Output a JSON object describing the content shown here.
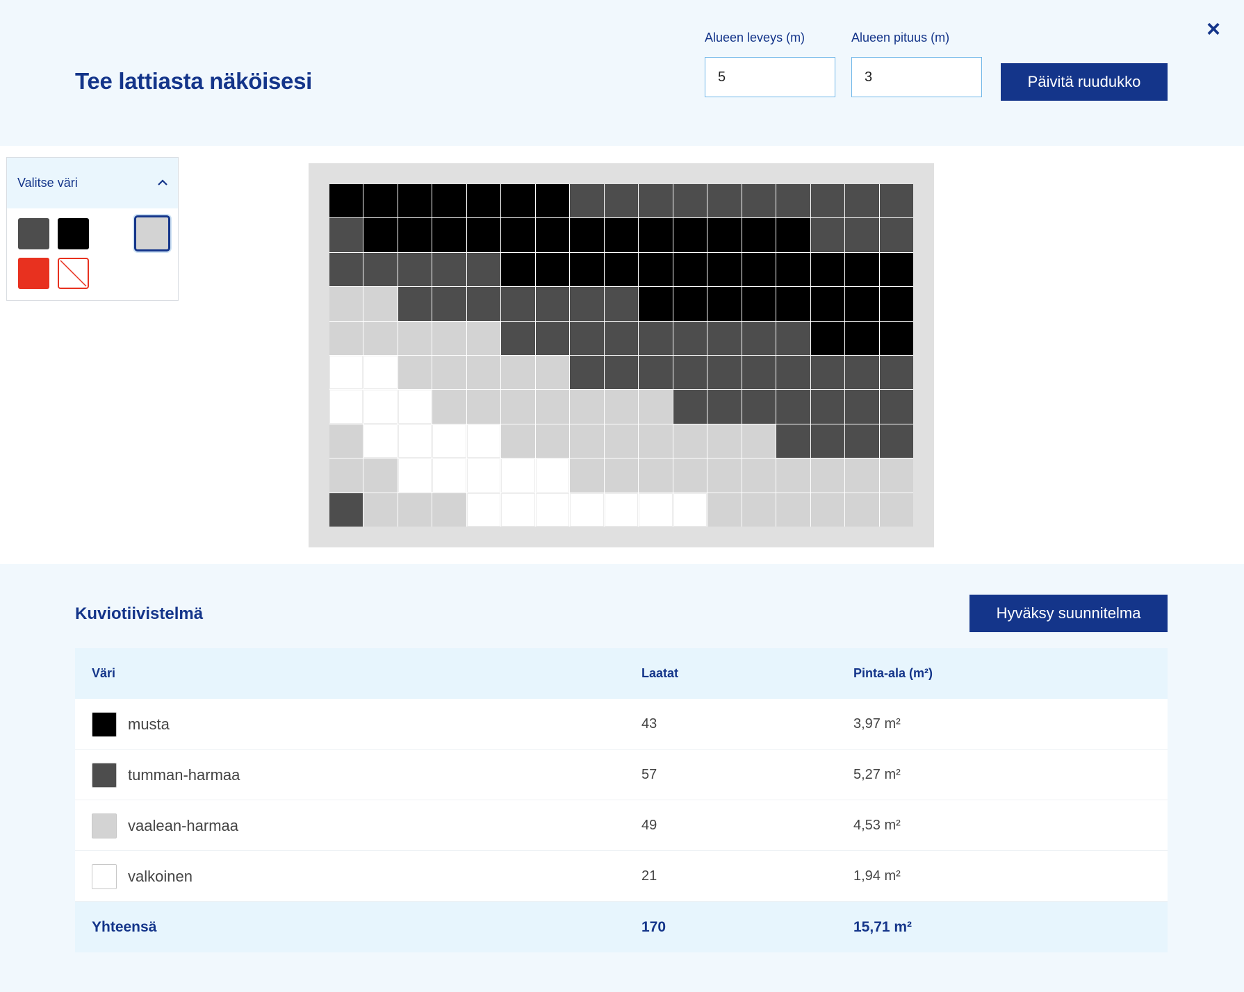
{
  "header": {
    "title": "Tee lattiasta näköisesi",
    "width_label": "Alueen leveys (m)",
    "width_value": "5",
    "length_label": "Alueen pituus (m)",
    "length_value": "3",
    "update_button": "Päivitä ruudukko",
    "close_icon": "×"
  },
  "palette": {
    "title": "Valitse väri",
    "collapse_icon": "chevron-up-icon",
    "colors": {
      "dark_gray": "#4d4d4d",
      "black": "#000000",
      "white": "#ffffff",
      "light_gray": "#d3d3d3",
      "red": "#e8311f",
      "selected_border": "#14358a"
    },
    "selected": "light_gray"
  },
  "grid": {
    "columns": 17,
    "rows_count": 10,
    "legend": {
      "B": "#000000",
      "D": "#4d4d4d",
      "L": "#d3d3d3",
      "W": "#ffffff"
    },
    "rows": [
      "BBBBBBBDDDDDDDDDD",
      "DBBBBBBBBBBBBBDDD",
      "DDDDDBBBBBBBBBBBB",
      "LLDDDDDDDBBBBBBBB",
      "LLLLLDDDDDDDDDBBB",
      "WWLLLLLDDDDDDDDDD",
      "WWWLLLLLLLDDDDDDD",
      "LWWWWLLLLLLLLDDDD",
      "LLWWWWWLLLLLLLLLL",
      "DLLLWWWWWWWLLLLLL"
    ]
  },
  "summary": {
    "title": "Kuviotiivistelmä",
    "approve_button": "Hyväksy suunnitelma",
    "columns": [
      "Väri",
      "Laatat",
      "Pinta-ala (m²)"
    ],
    "rows": [
      {
        "color": "#000000",
        "name": "musta",
        "tiles": "43",
        "area": "3,97 m²"
      },
      {
        "color": "#4d4d4d",
        "name": "tumman-harmaa",
        "tiles": "57",
        "area": "5,27 m²"
      },
      {
        "color": "#d3d3d3",
        "name": "vaalean-harmaa",
        "tiles": "49",
        "area": "4,53 m²"
      },
      {
        "color": "#ffffff",
        "name": "valkoinen",
        "tiles": "21",
        "area": "1,94 m²"
      }
    ],
    "total": {
      "label": "Yhteensä",
      "tiles": "170",
      "area": "15,71 m²"
    }
  }
}
